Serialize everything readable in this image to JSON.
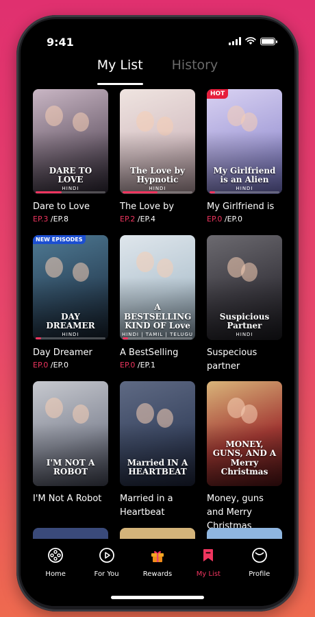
{
  "status": {
    "time": "9:41"
  },
  "tabs": [
    {
      "label": "My List",
      "active": true
    },
    {
      "label": "History",
      "active": false
    }
  ],
  "items": [
    {
      "title": "Dare to Love",
      "poster_text": "DARE TO LOVE",
      "poster_lang": "HINDI",
      "badge": "",
      "ep_current": "EP.3",
      "ep_total": " /EP.8",
      "progress": 0.375,
      "colors": [
        "#c9b6c4",
        "#7a6b7a",
        "#2a2430"
      ]
    },
    {
      "title": "The Love by",
      "poster_text": "The Love by Hypnotic",
      "poster_lang": "HINDI",
      "badge": "",
      "ep_current": "EP.2",
      "ep_total": " /EP.4",
      "progress": 0.5,
      "colors": [
        "#efe4e0",
        "#d7c3c6",
        "#a58e93"
      ]
    },
    {
      "title": "My Girlfriend is",
      "poster_text": "My Girlfriend is an Alien",
      "poster_lang": "HINDI",
      "badge": "HOT",
      "ep_current": "EP.0",
      "ep_total": " /EP.0",
      "progress": 0.0,
      "colors": [
        "#d9d2f2",
        "#a8a2da",
        "#6c6bb8"
      ]
    },
    {
      "title": "Day Dreamer",
      "poster_text": "DAY DREAMER",
      "poster_lang": "HINDI",
      "badge": "NEW EPISODES",
      "ep_current": "EP.0",
      "ep_total": " /EP.0",
      "progress": 0.0,
      "colors": [
        "#4f7a94",
        "#2f4a60",
        "#141d28"
      ]
    },
    {
      "title": "A BestSelling",
      "poster_text": "A BESTSELLING KIND OF Love",
      "poster_lang": "HINDI | TAMIL | TELUGU",
      "badge": "",
      "ep_current": "EP.0",
      "ep_total": " /EP.1",
      "progress": 0.0,
      "colors": [
        "#dfe6ec",
        "#b9c9d4",
        "#7d8f9c"
      ]
    },
    {
      "title": "Suspecious partner",
      "poster_text": "Suspicious Partner",
      "poster_lang": "HINDI",
      "badge": "",
      "ep_current": "",
      "ep_total": "",
      "progress": 0.0,
      "colors": [
        "#6c6a70",
        "#3d3b42",
        "#1a191e"
      ]
    },
    {
      "title": "I'M Not A Robot",
      "poster_text": "I'M NOT A ROBOT",
      "poster_lang": "",
      "badge": "",
      "ep_current": "",
      "ep_total": "",
      "progress": 0.0,
      "colors": [
        "#c7c9cf",
        "#8b8f9c",
        "#3f4250"
      ]
    },
    {
      "title": "Married in a Heartbeat",
      "poster_text": "Married IN A HEARTBEAT",
      "poster_lang": "",
      "badge": "",
      "ep_current": "",
      "ep_total": "",
      "progress": 0.0,
      "colors": [
        "#5f6a84",
        "#3b4762",
        "#1c2236"
      ]
    },
    {
      "title": "Money, guns and Merry Christmas",
      "poster_text": "MONEY, GUNS, AND A Merry Christmas",
      "poster_lang": "",
      "badge": "",
      "ep_current": "",
      "ep_total": "",
      "progress": 0.0,
      "colors": [
        "#d9b57a",
        "#a33a34",
        "#4a1214"
      ]
    }
  ],
  "partial_colors": [
    "#3a4a7a",
    "#d4b47a",
    "#8fb6e0"
  ],
  "nav": [
    {
      "label": "Home",
      "icon": "film-reel-icon",
      "active": false
    },
    {
      "label": "For You",
      "icon": "play-circle-icon",
      "active": false
    },
    {
      "label": "Rewards",
      "icon": "gift-icon",
      "active": false
    },
    {
      "label": "My List",
      "icon": "bookmark-icon",
      "active": true
    },
    {
      "label": "Profile",
      "icon": "profile-icon",
      "active": false
    }
  ],
  "colors": {
    "accent": "#f0355f",
    "inactive_tab": "#6a6a6a",
    "gift": "#f5a623"
  }
}
